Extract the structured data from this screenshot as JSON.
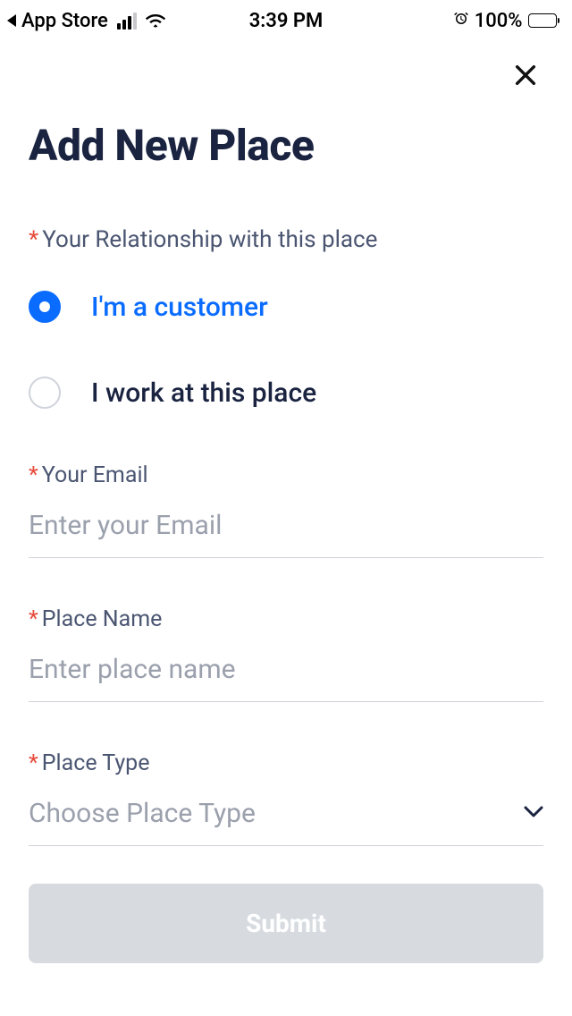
{
  "status_bar": {
    "back_label": "App Store",
    "time": "3:39 PM",
    "battery_pct": "100%"
  },
  "page": {
    "title": "Add New Place"
  },
  "relationship": {
    "label": "Your Relationship with this place",
    "options": [
      {
        "label": "I'm a customer",
        "selected": true
      },
      {
        "label": "I work at this place",
        "selected": false
      }
    ]
  },
  "email": {
    "label": "Your Email",
    "placeholder": "Enter your Email",
    "value": ""
  },
  "place_name": {
    "label": "Place Name",
    "placeholder": "Enter place name",
    "value": ""
  },
  "place_type": {
    "label": "Place Type",
    "placeholder": "Choose Place Type",
    "value": ""
  },
  "submit": {
    "label": "Submit"
  }
}
